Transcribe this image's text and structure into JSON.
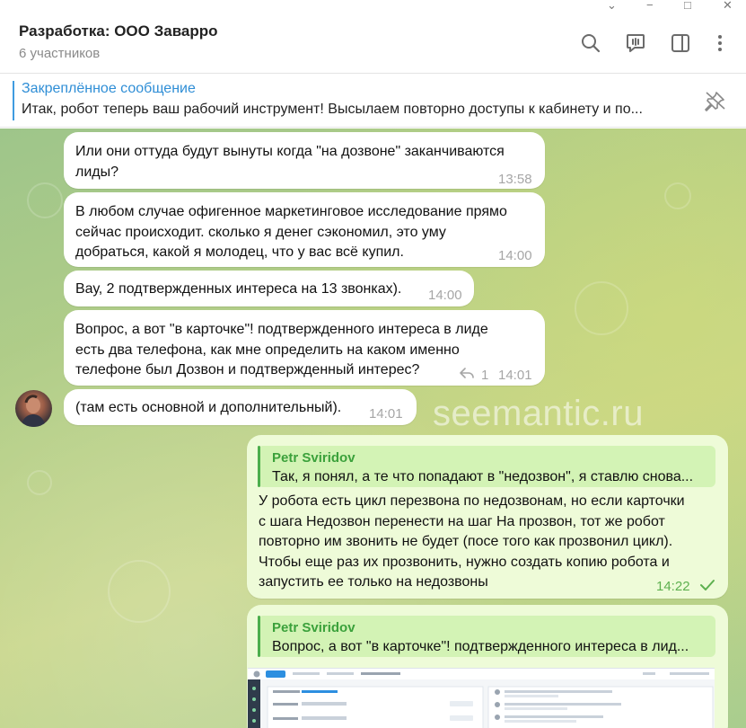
{
  "window": {
    "controls": [
      "⌄",
      "−",
      "□",
      "✕"
    ]
  },
  "header": {
    "title": "Разработка: ООО Заварро",
    "subtitle": "6 участников",
    "icons": [
      "search-icon",
      "video-chat-icon",
      "sidebar-toggle-icon",
      "more-vertical-icon"
    ]
  },
  "pinned": {
    "title": "Закреплённое сообщение",
    "text": "Итак, робот теперь ваш рабочий инструмент!  Высылаем повторно доступы к кабинету и по..."
  },
  "watermark": "seemantic.ru",
  "messages": [
    {
      "lines": [
        "Или они оттуда будут вынуты когда \"на дозвоне\" заканчиваются",
        "лиды?"
      ],
      "time": "13:58"
    },
    {
      "lines": [
        "В любом случае офигенное маркетинговое исследование прямо",
        "сейчас происходит. сколько я денег сэкономил, это уму",
        "добраться, какой я молодец, что у вас всё купил."
      ],
      "time": "14:00"
    },
    {
      "lines": [
        "Вау, 2 подтвержденных интереса на 13 звонках)."
      ],
      "time": "14:00"
    },
    {
      "lines": [
        "Вопрос, а вот \"в карточке\"! подтвержденного интереса в лиде",
        "есть два телефона, как мне определить на каком именно",
        "телефоне был Дозвон и подтвержденный интерес?"
      ],
      "time": "14:01",
      "replies": "1"
    },
    {
      "lines": [
        "(там есть основной и дополнительный)."
      ],
      "time": "14:01"
    }
  ],
  "outgoing": [
    {
      "reply_name": "Petr Sviridov",
      "reply_text": "Так, я понял, а те что попадают в \"недозвон\", я ставлю снова...",
      "lines": [
        "У робота есть цикл перезвона по недозвонам, но если карточки",
        "с шага Недозвон перенести на шаг На прозвон, тот же робот",
        "повторно им звонить не будет (посе того как прозвонил цикл).",
        "Чтобы еще раз их прозвонить, нужно создать копию робота и",
        "запустить ее только на недозвоны"
      ],
      "time": "14:22"
    },
    {
      "reply_name": "Petr Sviridov",
      "reply_text": "Вопрос, а вот \"в карточке\"! подтвержденного интереса в лид..."
    }
  ],
  "colors": {
    "accent": "#3f9be0",
    "outgoing_bubble": "#eefbd8",
    "outgoing_time": "#5db04f",
    "reply_name": "#3ba13b"
  }
}
